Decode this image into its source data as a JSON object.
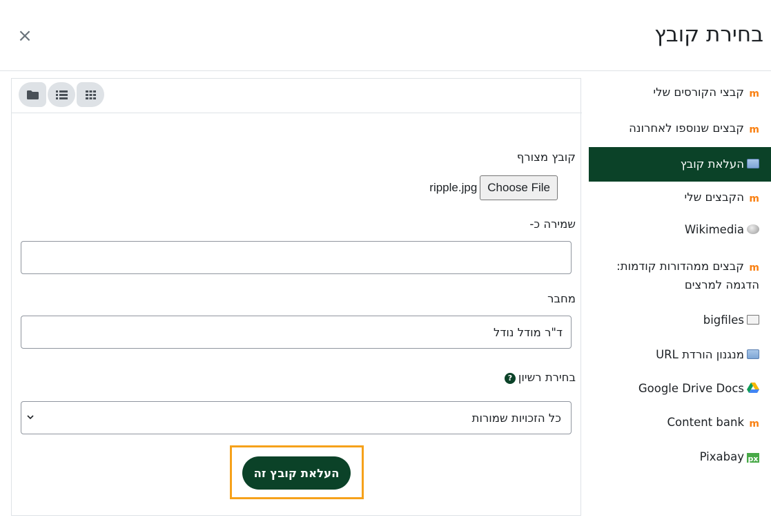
{
  "dialog": {
    "title": "בחירת קובץ",
    "close_label": "×"
  },
  "sidebar": {
    "items": [
      {
        "label": "קבצי הקורסים שלי",
        "icon": "moodle-icon",
        "active": false
      },
      {
        "label": "קבצים שנוספו לאחרונה",
        "icon": "moodle-icon",
        "active": false
      },
      {
        "label": "העלאת קובץ",
        "icon": "upload-icon",
        "active": true
      },
      {
        "label": "הקבצים שלי",
        "icon": "moodle-icon",
        "active": false
      },
      {
        "label": "Wikimedia",
        "icon": "wikimedia-icon",
        "active": false
      },
      {
        "label": "קבצים ממהדורות קודמות: הדגמה למרצים",
        "icon": "moodle-icon",
        "active": false
      },
      {
        "label": "bigfiles",
        "icon": "file-icon",
        "active": false
      },
      {
        "label": "מנגנון הורדת URL",
        "icon": "upload-icon",
        "active": false
      },
      {
        "label": "Google Drive Docs",
        "icon": "google-drive-icon",
        "active": false
      },
      {
        "label": "Content bank",
        "icon": "moodle-icon",
        "active": false
      },
      {
        "label": "Pixabay",
        "icon": "pixabay-icon",
        "active": false
      }
    ]
  },
  "toolbar": {
    "views": [
      "folder-view-icon",
      "list-view-icon",
      "grid-view-icon"
    ]
  },
  "form": {
    "attachment_label": "קובץ מצורף",
    "file_name": "ripple.jpg",
    "choose_file_label": "Choose File",
    "save_as_label": "שמירה כ-",
    "save_as_value": "",
    "author_label": "מחבר",
    "author_value": "ד\"ר מודל נודל",
    "license_label": "בחירת רשיון",
    "license_value": "כל הזכויות שמורות",
    "upload_button_label": "העלאת קובץ זה"
  },
  "colors": {
    "brand": "#0b4228",
    "highlight": "#f6a11a",
    "moodle_orange": "#f98012"
  }
}
